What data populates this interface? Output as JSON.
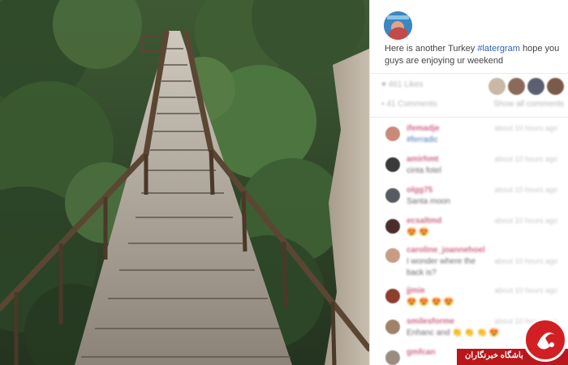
{
  "post": {
    "caption_prefix": "Here is another Turkey ",
    "hashtag": "#latergram",
    "caption_suffix": " hope you guys are enjoying ur weekend"
  },
  "stats": {
    "likes": "461 Likes",
    "comments": "41 Comments",
    "show_all": "Show all comments"
  },
  "comments": [
    {
      "user": "ifemadje",
      "text": "#ferradic",
      "time": "about 10 hours ago",
      "avatar_color": "#c98a7a"
    },
    {
      "user": "amirhmt",
      "text": "cinta fotel",
      "time": "about 10 hours ago",
      "avatar_color": "#3a3a3a"
    },
    {
      "user": "olgg75",
      "text": "Santa moon",
      "time": "about 10 hours ago",
      "avatar_color": "#555b60"
    },
    {
      "user": "ecsaltmd",
      "text": "😍 😍",
      "time": "about 10 hours ago",
      "avatar_color": "#4a2d2a"
    },
    {
      "user": "caroline_joannehoel",
      "text": "I wonder where the",
      "text2": "back is?",
      "time": "about 10 hours ago",
      "avatar_color": "#c99b86"
    },
    {
      "user": "jjmie",
      "text": "😍 😍 😍 😍",
      "time": "about 10 hours ago",
      "avatar_color": "#8c3f2e"
    },
    {
      "user": "smilesforme",
      "text": "Enhanc and 👏 👏 👏 😍",
      "time": "about 10 hours ago",
      "avatar_color": "#a0826a"
    },
    {
      "user": "gmfcan",
      "text": "",
      "time": "",
      "avatar_color": "#9a8c80"
    }
  ],
  "watermark": {
    "text": "باشگاه خبرنگاران"
  },
  "colors": {
    "hashtag": "#2f5fb5",
    "username": "#d06a86",
    "watermark_red": "#b8181c"
  }
}
